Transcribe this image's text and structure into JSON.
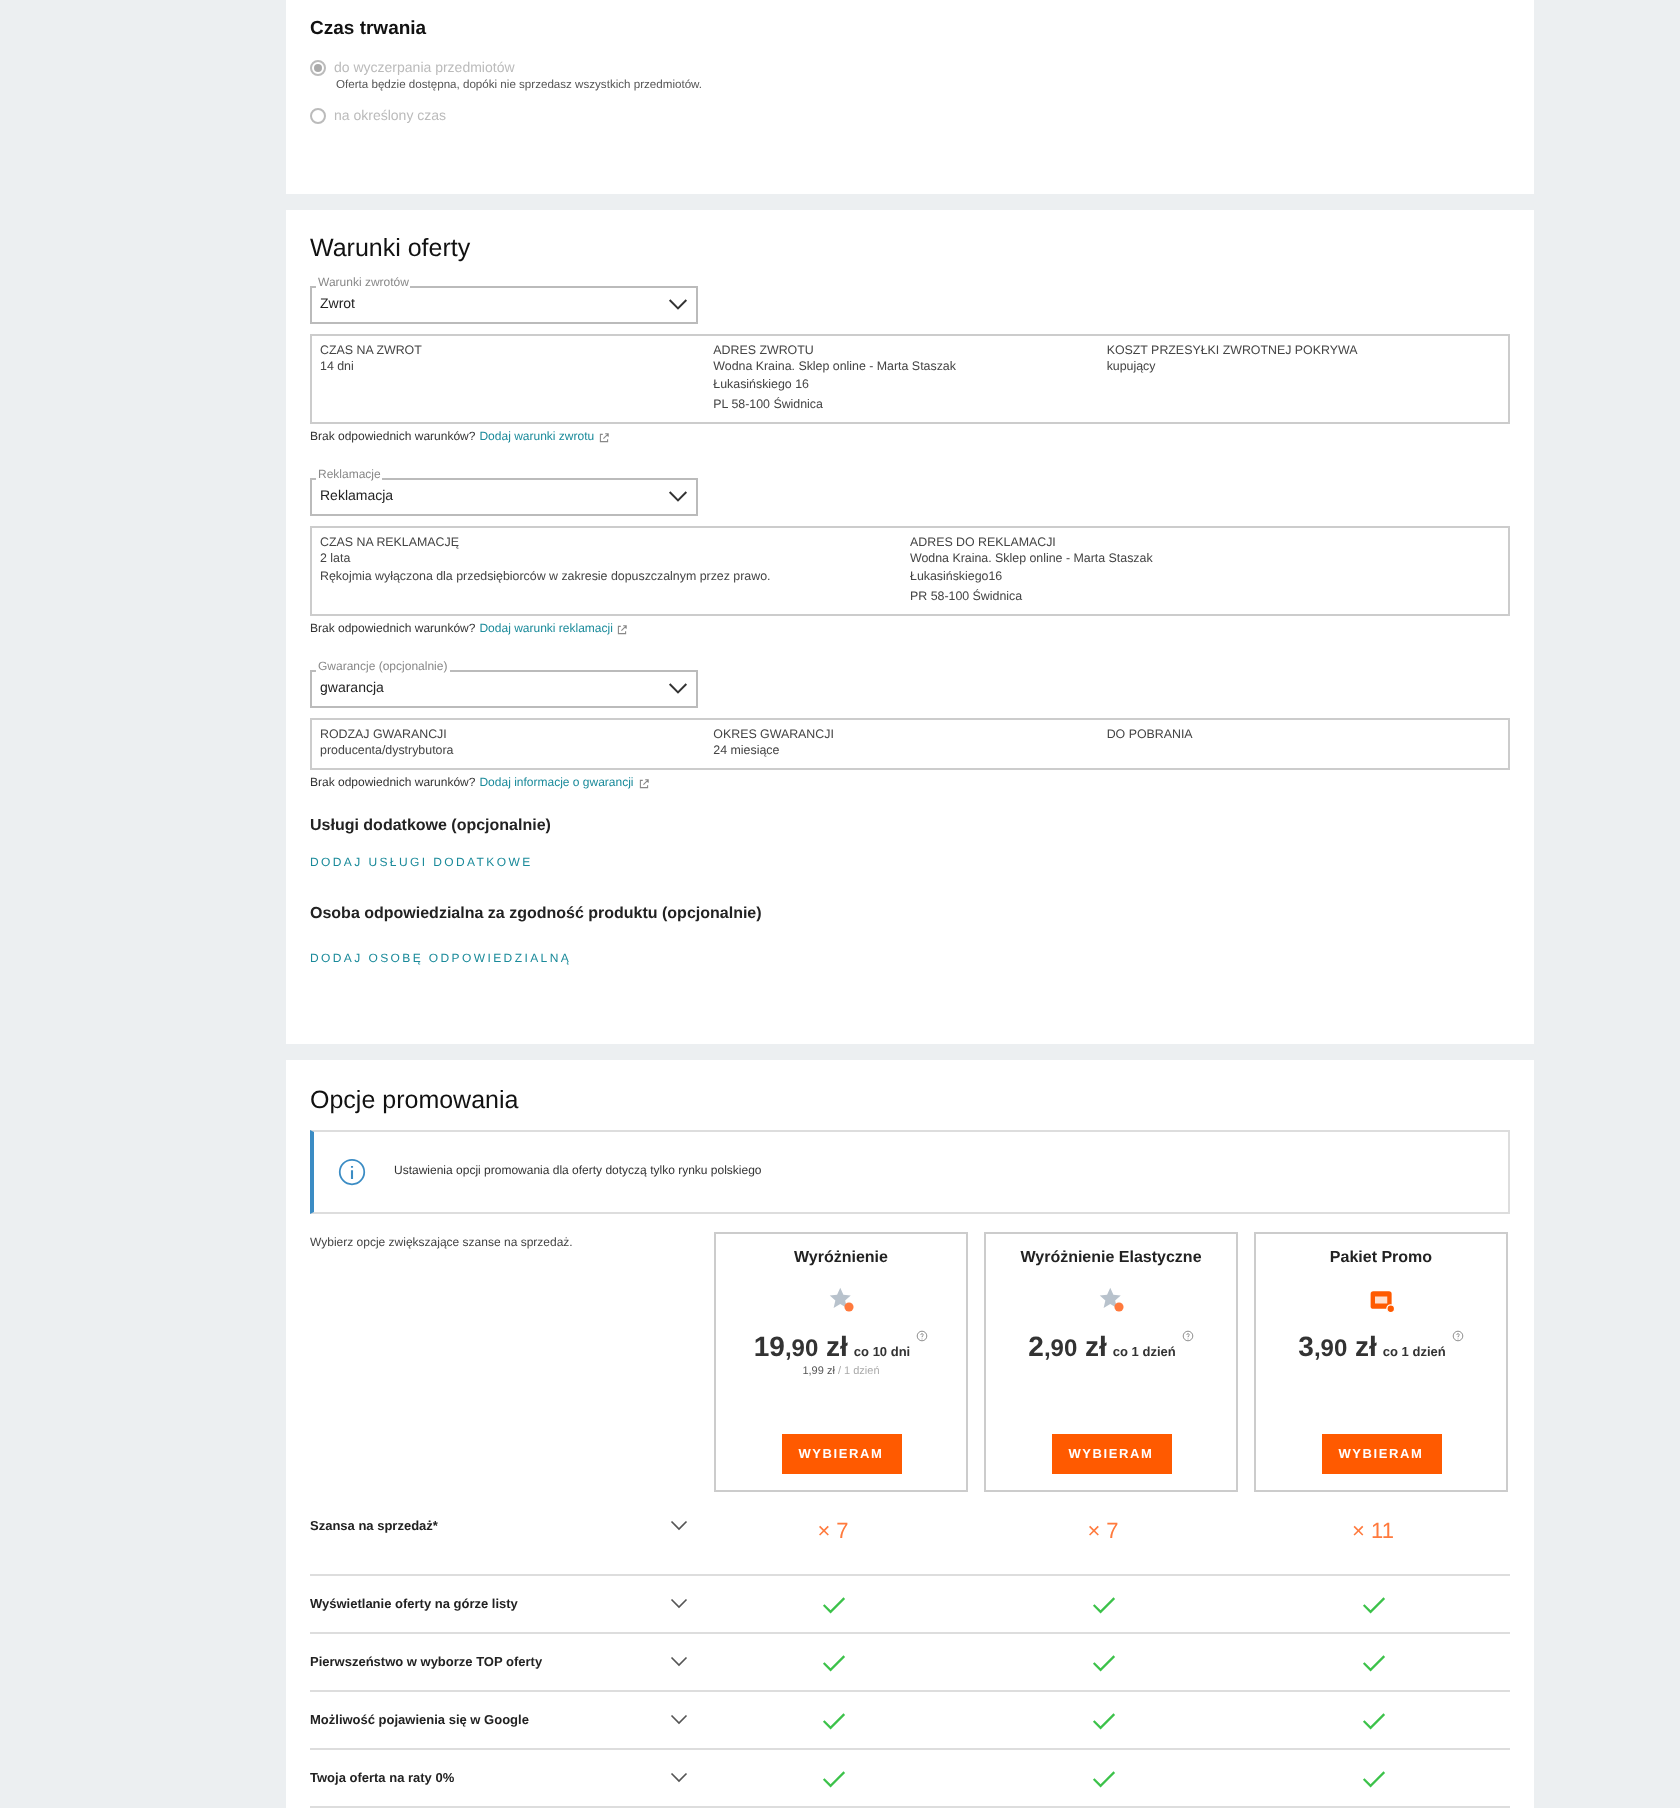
{
  "duration": {
    "title": "Czas trwania",
    "options": [
      {
        "label": "do wyczerpania przedmiotów",
        "description": "Oferta będzie dostępna, dopóki nie sprzedasz wszystkich przedmiotów.",
        "selected": true,
        "disabled": true
      },
      {
        "label": "na określony czas",
        "selected": false,
        "disabled": true
      }
    ]
  },
  "terms": {
    "title": "Warunki oferty",
    "sections": [
      {
        "select_label": "Warunki zwrotów",
        "value": "Zwrot",
        "details": [
          {
            "label": "CZAS NA ZWROT",
            "lines": [
              "14 dni"
            ]
          },
          {
            "label": "ADRES ZWROTU",
            "lines": [
              "Wodna Kraina. Sklep online - Marta Staszak",
              "Łukasińskiego 16",
              "PL 58-100 Świdnica"
            ]
          },
          {
            "label": "KOSZT PRZESYŁKI ZWROTNEJ POKRYWA",
            "lines": [
              "kupujący"
            ]
          }
        ],
        "note": "Brak odpowiednich warunków?",
        "link": "Dodaj warunki zwrotu"
      },
      {
        "select_label": "Reklamacje",
        "value": "Reklamacja",
        "details": [
          {
            "label": "CZAS NA REKLAMACJĘ",
            "lines": [
              "2 lata",
              "Rękojmia wyłączona dla przedsiębiorców w zakresie dopuszczalnym przez prawo."
            ]
          },
          {
            "label": "ADRES DO REKLAMACJI",
            "lines": [
              "Wodna Kraina. Sklep online - Marta Staszak",
              "Łukasińskiego16",
              "PR 58-100 Świdnica"
            ]
          }
        ],
        "note": "Brak odpowiednich warunków?",
        "link": "Dodaj warunki reklamacji"
      },
      {
        "select_label": "Gwarancje (opcjonalnie)",
        "value": "gwarancja",
        "details": [
          {
            "label": "RODZAJ GWARANCJI",
            "lines": [
              "producenta/dystrybutora"
            ]
          },
          {
            "label": "OKRES GWARANCJI",
            "lines": [
              "24 miesiące"
            ]
          },
          {
            "label": "DO POBRANIA"
          }
        ],
        "note": "Brak odpowiednich warunków?",
        "link": "Dodaj informacje o gwarancji"
      }
    ],
    "extras": [
      {
        "title": "Usługi dodatkowe (opcjonalnie)",
        "action": "DODAJ USŁUGI DODATKOWE"
      },
      {
        "title": "Osoba odpowiedzialna za zgodność produktu (opcjonalnie)",
        "action": "DODAJ OSOBĘ ODPOWIEDZIALNĄ"
      }
    ]
  },
  "promo": {
    "title": "Opcje promowania",
    "info": "Ustawienia opcji promowania dla oferty dotyczą tylko rynku polskiego",
    "intro": "Wybierz opcje zwiększające szanse na sprzedaż.",
    "packages": [
      {
        "name": "Wyróżnienie",
        "kind": "highlight",
        "whole": "19",
        "fraction": ",90",
        "currency": "zł",
        "period": "co 10 dni",
        "sub_price": "1,99 zł",
        "sub_period": "/ 1 dzień",
        "button": "WYBIERAM"
      },
      {
        "name": "Wyróżnienie Elastyczne",
        "kind": "highlight",
        "whole": "2",
        "fraction": ",90",
        "currency": "zł",
        "period": "co 1 dzień",
        "button": "WYBIERAM"
      },
      {
        "name": "Pakiet Promo",
        "kind": "bundle",
        "whole": "3",
        "fraction": ",90",
        "currency": "zł",
        "period": "co 1 dzień",
        "button": "WYBIERAM"
      }
    ],
    "features": [
      {
        "label": "Szansa na sprzedaż*",
        "values": [
          {
            "kind": "multiplier",
            "text": "× 7"
          },
          {
            "kind": "multiplier",
            "text": "× 7"
          },
          {
            "kind": "multiplier",
            "text": "× 11"
          }
        ]
      },
      {
        "label": "Wyświetlanie oferty na górze listy",
        "values": [
          {
            "kind": "check"
          },
          {
            "kind": "check"
          },
          {
            "kind": "check"
          }
        ]
      },
      {
        "label": "Pierwszeństwo w wyborze TOP oferty",
        "values": [
          {
            "kind": "check"
          },
          {
            "kind": "check"
          },
          {
            "kind": "check"
          }
        ]
      },
      {
        "label": "Możliwość pojawienia się w Google",
        "values": [
          {
            "kind": "check"
          },
          {
            "kind": "check"
          },
          {
            "kind": "check"
          }
        ]
      },
      {
        "label": "Twoja oferta na raty 0%",
        "values": [
          {
            "kind": "check"
          },
          {
            "kind": "check"
          },
          {
            "kind": "check"
          }
        ]
      }
    ]
  }
}
